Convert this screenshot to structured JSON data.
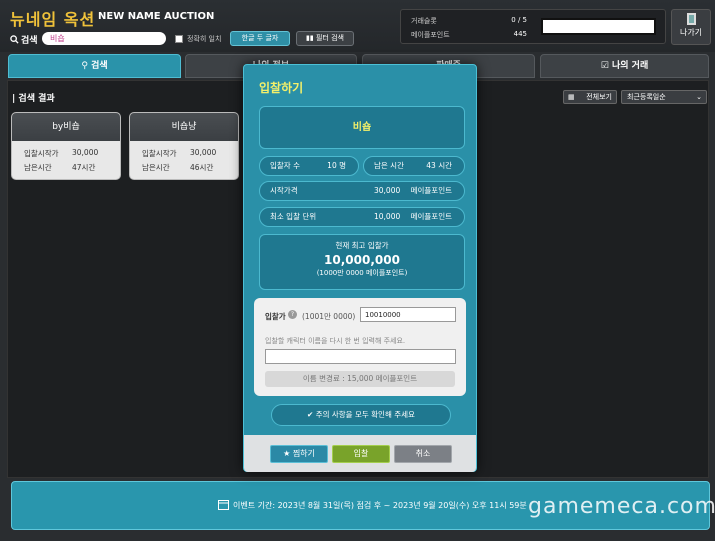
{
  "header": {
    "title": "뉴네임 옥션",
    "subtitle": "NEW NAME AUCTION",
    "search_label": "검색",
    "search_value": "비숍",
    "exact_match_label": "정확히 일치",
    "korean_filter_btn": "한글 두 글자",
    "filter_search_btn": "필터 검색",
    "info": {
      "slots_label": "거래슬롯",
      "slots_value": "0 / 5",
      "points_label": "메이플포인트",
      "points_value": "445"
    },
    "exit_label": "나가기"
  },
  "tabs": [
    {
      "label": "검색",
      "active": true
    },
    {
      "label": "나의 정보",
      "active": false
    },
    {
      "label": "판매중",
      "active": false
    },
    {
      "label": "나의 거래",
      "active": false
    }
  ],
  "results": {
    "title": "검색 결과",
    "view_all": "전체보기",
    "sort_option": "최근등록일순",
    "cards": [
      {
        "name": "by비숍",
        "start_label": "입찰시작가",
        "start_value": "30,000",
        "remain_label": "남은시간",
        "remain_value": "47시간"
      },
      {
        "name": "비숍냥",
        "start_label": "입찰시작가",
        "start_value": "30,000",
        "remain_label": "남은시간",
        "remain_value": "46시간"
      }
    ]
  },
  "modal": {
    "title": "입찰하기",
    "item_name": "비숍",
    "bidders_label": "입찰자 수",
    "bidders_value": "10 명",
    "remain_label": "남은 시간",
    "remain_value": "43 시간",
    "start_price_label": "시작가격",
    "start_price_value": "30,000",
    "start_price_unit": "메이플포인트",
    "min_unit_label": "최소 입찰 단위",
    "min_unit_value": "10,000",
    "min_unit_unit": "메이플포인트",
    "current_bid_label": "현재 최고 입찰가",
    "current_bid_value": "10,000,000",
    "current_bid_sub": "(1000만 0000 메이플포인트)",
    "bid_label": "입찰가",
    "bid_hint": "(1001만 0000)",
    "bid_input_value": "10010000",
    "name_prompt": "입찰할 캐릭터 이름을 다시 한 번 입력해 주세요.",
    "name_input_value": "",
    "fee_text": "이름 변경료 : 15,000 메이플포인트",
    "confirm_text": "주의 사항을 모두 확인해 주세요",
    "buttons": {
      "favorite": "찜하기",
      "bid": "입찰",
      "cancel": "취소"
    }
  },
  "event": {
    "text": "이벤트 기간: 2023년 8월 31일(목) 점검 후 ~ 2023년 9월 20일(수) 오후 11시 59분"
  },
  "watermark": "gamemeca.com"
}
